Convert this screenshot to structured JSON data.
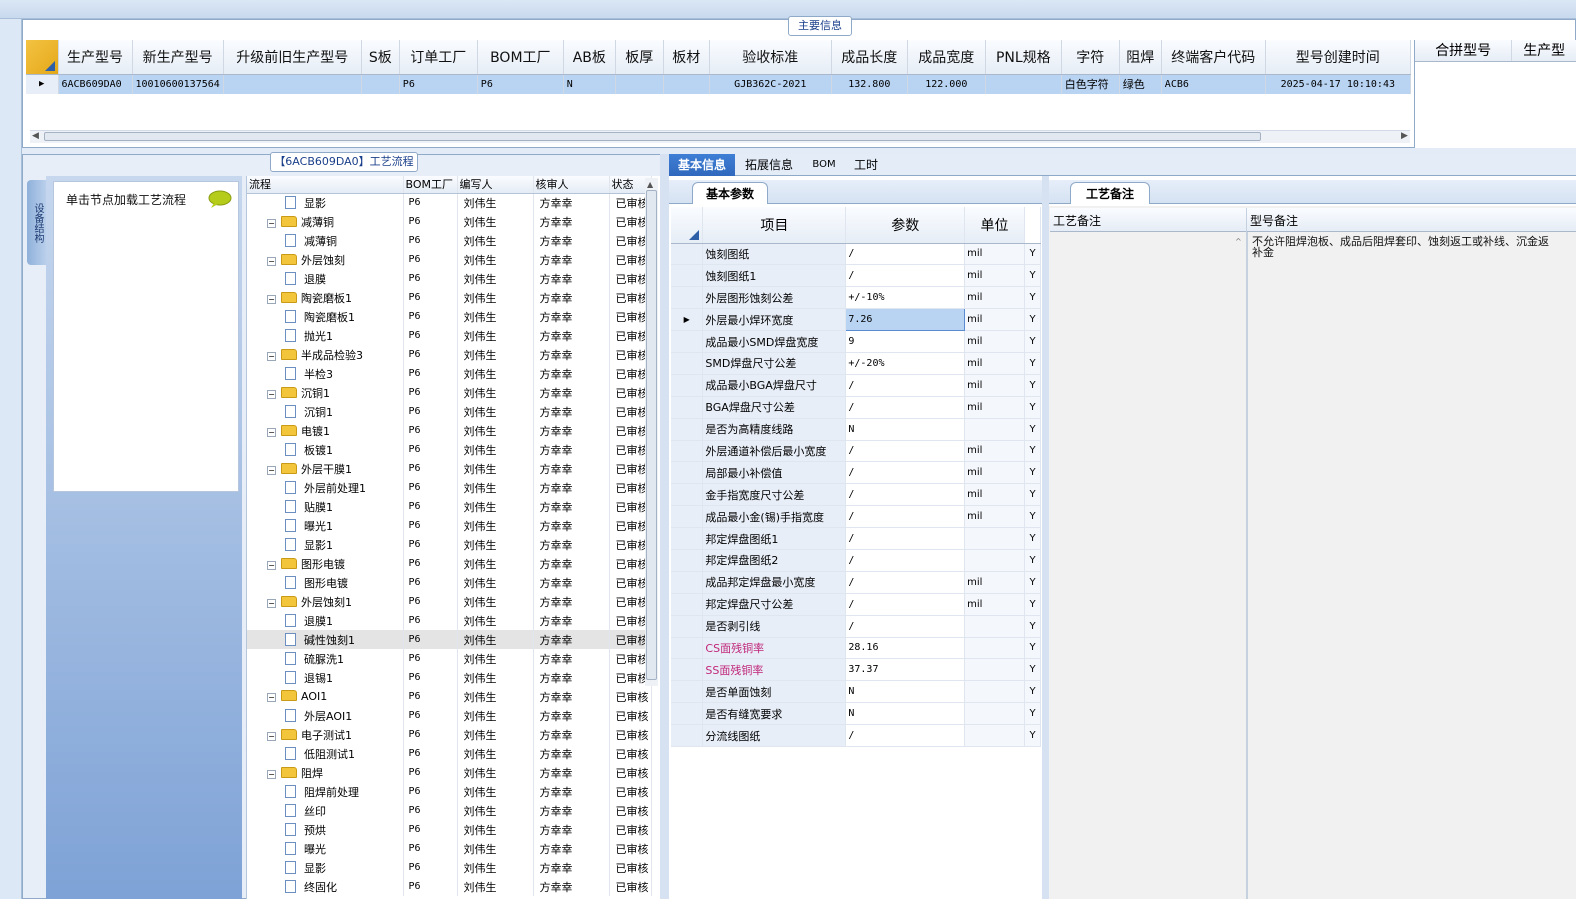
{
  "main_info": {
    "title": "主要信息",
    "columns": [
      "生产型号",
      "新生产型号",
      "升级前旧生产型号",
      "S板",
      "订单工厂",
      "BOM工厂",
      "AB板",
      "板厚",
      "板材",
      "验收标准",
      "成品长度",
      "成品宽度",
      "PNL规格",
      "字符",
      "阻焊",
      "终端客户代码",
      "型号创建时间"
    ],
    "row": [
      "6ACB609DA0",
      "10010600137564",
      "",
      "",
      "P6",
      "P6",
      "N",
      "",
      "",
      "GJB362C-2021",
      "132.800",
      "122.000",
      "",
      "白色字符",
      "绿色",
      "ACB6",
      "2025-04-17 10:10:43"
    ],
    "extra_columns": [
      "合拼型号",
      "生产型"
    ]
  },
  "process": {
    "title": "【6ACB609DA0】工艺流程",
    "side_tab": "设备结构",
    "nav_hint": "单击节点加载工艺流程",
    "tree_headers": [
      "流程",
      "BOM工厂",
      "编写人",
      "核审人",
      "状态"
    ],
    "tree_rows": [
      {
        "lvl": 2,
        "type": "doc",
        "name": "显影",
        "bom": "P6",
        "writer": "刘伟生",
        "checker": "方幸幸",
        "status": "已审核"
      },
      {
        "lvl": 1,
        "type": "folder",
        "name": "减薄铜",
        "bom": "P6",
        "writer": "刘伟生",
        "checker": "方幸幸",
        "status": "已审核"
      },
      {
        "lvl": 2,
        "type": "doc",
        "name": "减薄铜",
        "bom": "P6",
        "writer": "刘伟生",
        "checker": "方幸幸",
        "status": "已审核"
      },
      {
        "lvl": 1,
        "type": "folder",
        "name": "外层蚀刻",
        "bom": "P6",
        "writer": "刘伟生",
        "checker": "方幸幸",
        "status": "已审核"
      },
      {
        "lvl": 2,
        "type": "doc",
        "name": "退膜",
        "bom": "P6",
        "writer": "刘伟生",
        "checker": "方幸幸",
        "status": "已审核"
      },
      {
        "lvl": 1,
        "type": "folder",
        "name": "陶瓷磨板1",
        "bom": "P6",
        "writer": "刘伟生",
        "checker": "方幸幸",
        "status": "已审核"
      },
      {
        "lvl": 2,
        "type": "doc",
        "name": "陶瓷磨板1",
        "bom": "P6",
        "writer": "刘伟生",
        "checker": "方幸幸",
        "status": "已审核"
      },
      {
        "lvl": 2,
        "type": "doc",
        "name": "抛光1",
        "bom": "P6",
        "writer": "刘伟生",
        "checker": "方幸幸",
        "status": "已审核"
      },
      {
        "lvl": 1,
        "type": "folder",
        "name": "半成品检验3",
        "bom": "P6",
        "writer": "刘伟生",
        "checker": "方幸幸",
        "status": "已审核"
      },
      {
        "lvl": 2,
        "type": "doc",
        "name": "半检3",
        "bom": "P6",
        "writer": "刘伟生",
        "checker": "方幸幸",
        "status": "已审核"
      },
      {
        "lvl": 1,
        "type": "folder",
        "name": "沉铜1",
        "bom": "P6",
        "writer": "刘伟生",
        "checker": "方幸幸",
        "status": "已审核"
      },
      {
        "lvl": 2,
        "type": "doc",
        "name": "沉铜1",
        "bom": "P6",
        "writer": "刘伟生",
        "checker": "方幸幸",
        "status": "已审核"
      },
      {
        "lvl": 1,
        "type": "folder",
        "name": "电镀1",
        "bom": "P6",
        "writer": "刘伟生",
        "checker": "方幸幸",
        "status": "已审核"
      },
      {
        "lvl": 2,
        "type": "doc",
        "name": "板镀1",
        "bom": "P6",
        "writer": "刘伟生",
        "checker": "方幸幸",
        "status": "已审核"
      },
      {
        "lvl": 1,
        "type": "folder",
        "name": "外层干膜1",
        "bom": "P6",
        "writer": "刘伟生",
        "checker": "方幸幸",
        "status": "已审核"
      },
      {
        "lvl": 2,
        "type": "doc",
        "name": "外层前处理1",
        "bom": "P6",
        "writer": "刘伟生",
        "checker": "方幸幸",
        "status": "已审核"
      },
      {
        "lvl": 2,
        "type": "doc",
        "name": "贴膜1",
        "bom": "P6",
        "writer": "刘伟生",
        "checker": "方幸幸",
        "status": "已审核"
      },
      {
        "lvl": 2,
        "type": "doc",
        "name": "曝光1",
        "bom": "P6",
        "writer": "刘伟生",
        "checker": "方幸幸",
        "status": "已审核"
      },
      {
        "lvl": 2,
        "type": "doc",
        "name": "显影1",
        "bom": "P6",
        "writer": "刘伟生",
        "checker": "方幸幸",
        "status": "已审核"
      },
      {
        "lvl": 1,
        "type": "folder",
        "name": "图形电镀",
        "bom": "P6",
        "writer": "刘伟生",
        "checker": "方幸幸",
        "status": "已审核"
      },
      {
        "lvl": 2,
        "type": "doc",
        "name": "图形电镀",
        "bom": "P6",
        "writer": "刘伟生",
        "checker": "方幸幸",
        "status": "已审核"
      },
      {
        "lvl": 1,
        "type": "folder",
        "name": "外层蚀刻1",
        "bom": "P6",
        "writer": "刘伟生",
        "checker": "方幸幸",
        "status": "已审核"
      },
      {
        "lvl": 2,
        "type": "doc",
        "name": "退膜1",
        "bom": "P6",
        "writer": "刘伟生",
        "checker": "方幸幸",
        "status": "已审核"
      },
      {
        "lvl": 2,
        "type": "doc",
        "name": "碱性蚀刻1",
        "bom": "P6",
        "writer": "刘伟生",
        "checker": "方幸幸",
        "status": "已审核",
        "hl": true
      },
      {
        "lvl": 2,
        "type": "doc",
        "name": "硫脲洗1",
        "bom": "P6",
        "writer": "刘伟生",
        "checker": "方幸幸",
        "status": "已审核"
      },
      {
        "lvl": 2,
        "type": "doc",
        "name": "退锡1",
        "bom": "P6",
        "writer": "刘伟生",
        "checker": "方幸幸",
        "status": "已审核"
      },
      {
        "lvl": 1,
        "type": "folder",
        "name": "AOI1",
        "bom": "P6",
        "writer": "刘伟生",
        "checker": "方幸幸",
        "status": "已审核"
      },
      {
        "lvl": 2,
        "type": "doc",
        "name": "外层AOI1",
        "bom": "P6",
        "writer": "刘伟生",
        "checker": "方幸幸",
        "status": "已审核"
      },
      {
        "lvl": 1,
        "type": "folder",
        "name": "电子测试1",
        "bom": "P6",
        "writer": "刘伟生",
        "checker": "方幸幸",
        "status": "已审核"
      },
      {
        "lvl": 2,
        "type": "doc",
        "name": "低阻测试1",
        "bom": "P6",
        "writer": "刘伟生",
        "checker": "方幸幸",
        "status": "已审核"
      },
      {
        "lvl": 1,
        "type": "folder",
        "name": "阻焊",
        "bom": "P6",
        "writer": "刘伟生",
        "checker": "方幸幸",
        "status": "已审核"
      },
      {
        "lvl": 2,
        "type": "doc",
        "name": "阻焊前处理",
        "bom": "P6",
        "writer": "刘伟生",
        "checker": "方幸幸",
        "status": "已审核"
      },
      {
        "lvl": 2,
        "type": "doc",
        "name": "丝印",
        "bom": "P6",
        "writer": "刘伟生",
        "checker": "方幸幸",
        "status": "已审核"
      },
      {
        "lvl": 2,
        "type": "doc",
        "name": "预烘",
        "bom": "P6",
        "writer": "刘伟生",
        "checker": "方幸幸",
        "status": "已审核"
      },
      {
        "lvl": 2,
        "type": "doc",
        "name": "曝光",
        "bom": "P6",
        "writer": "刘伟生",
        "checker": "方幸幸",
        "status": "已审核"
      },
      {
        "lvl": 2,
        "type": "doc",
        "name": "显影",
        "bom": "P6",
        "writer": "刘伟生",
        "checker": "方幸幸",
        "status": "已审核"
      },
      {
        "lvl": 2,
        "type": "doc",
        "name": "终固化",
        "bom": "P6",
        "writer": "刘伟生",
        "checker": "方幸幸",
        "status": "已审核"
      }
    ]
  },
  "tabs": [
    "基本信息",
    "拓展信息",
    "BOM",
    "工时"
  ],
  "basic_params": {
    "title": "基本参数",
    "headers": [
      "项目",
      "参数",
      "单位"
    ],
    "rows": [
      {
        "item": "蚀刻图纸",
        "value": "/",
        "unit": "mil",
        "flag": "Y"
      },
      {
        "item": "蚀刻图纸1",
        "value": "/",
        "unit": "mil",
        "flag": "Y"
      },
      {
        "item": "外层图形蚀刻公差",
        "value": "+/-10%",
        "unit": "mil",
        "flag": "Y"
      },
      {
        "item": "外层最小焊环宽度",
        "value": "7.26",
        "unit": "mil",
        "flag": "Y",
        "selected": true
      },
      {
        "item": "成品最小SMD焊盘宽度",
        "value": "9",
        "unit": "mil",
        "flag": "Y"
      },
      {
        "item": "SMD焊盘尺寸公差",
        "value": "+/-20%",
        "unit": "mil",
        "flag": "Y"
      },
      {
        "item": "成品最小BGA焊盘尺寸",
        "value": "/",
        "unit": "mil",
        "flag": "Y"
      },
      {
        "item": "BGA焊盘尺寸公差",
        "value": "/",
        "unit": "mil",
        "flag": "Y"
      },
      {
        "item": "是否为高精度线路",
        "value": "N",
        "unit": "",
        "flag": "Y"
      },
      {
        "item": "外层通道补偿后最小宽度",
        "value": "/",
        "unit": "mil",
        "flag": "Y"
      },
      {
        "item": "局部最小补偿值",
        "value": "/",
        "unit": "mil",
        "flag": "Y"
      },
      {
        "item": "金手指宽度尺寸公差",
        "value": "/",
        "unit": "mil",
        "flag": "Y"
      },
      {
        "item": "成品最小金(锡)手指宽度",
        "value": "/",
        "unit": "mil",
        "flag": "Y"
      },
      {
        "item": "邦定焊盘图纸1",
        "value": "/",
        "unit": "",
        "flag": "Y"
      },
      {
        "item": "邦定焊盘图纸2",
        "value": "/",
        "unit": "",
        "flag": "Y"
      },
      {
        "item": "成品邦定焊盘最小宽度",
        "value": "/",
        "unit": "mil",
        "flag": "Y"
      },
      {
        "item": "邦定焊盘尺寸公差",
        "value": "/",
        "unit": "mil",
        "flag": "Y"
      },
      {
        "item": "是否剥引线",
        "value": "/",
        "unit": "",
        "flag": "Y"
      },
      {
        "item": "CS面残铜率",
        "value": "28.16",
        "unit": "",
        "flag": "Y",
        "pink": true
      },
      {
        "item": "SS面残铜率",
        "value": "37.37",
        "unit": "",
        "flag": "Y",
        "pink": true
      },
      {
        "item": "是否单面蚀刻",
        "value": "N",
        "unit": "",
        "flag": "Y"
      },
      {
        "item": "是否有缝宽要求",
        "value": "N",
        "unit": "",
        "flag": "Y"
      },
      {
        "item": "分流线图纸",
        "value": "/",
        "unit": "",
        "flag": "Y"
      }
    ]
  },
  "remarks": {
    "title": "工艺备注",
    "col1": "工艺备注",
    "col2": "型号备注",
    "text_line1": "不允许阻焊泡板、成品后阻焊套印、蚀刻返工或补线、沉金返",
    "text_line2": "补金"
  },
  "colors": {
    "selected_row": "#b9d4f3",
    "tab_active": "#2f68bd",
    "pink_text": "#c0267a"
  }
}
